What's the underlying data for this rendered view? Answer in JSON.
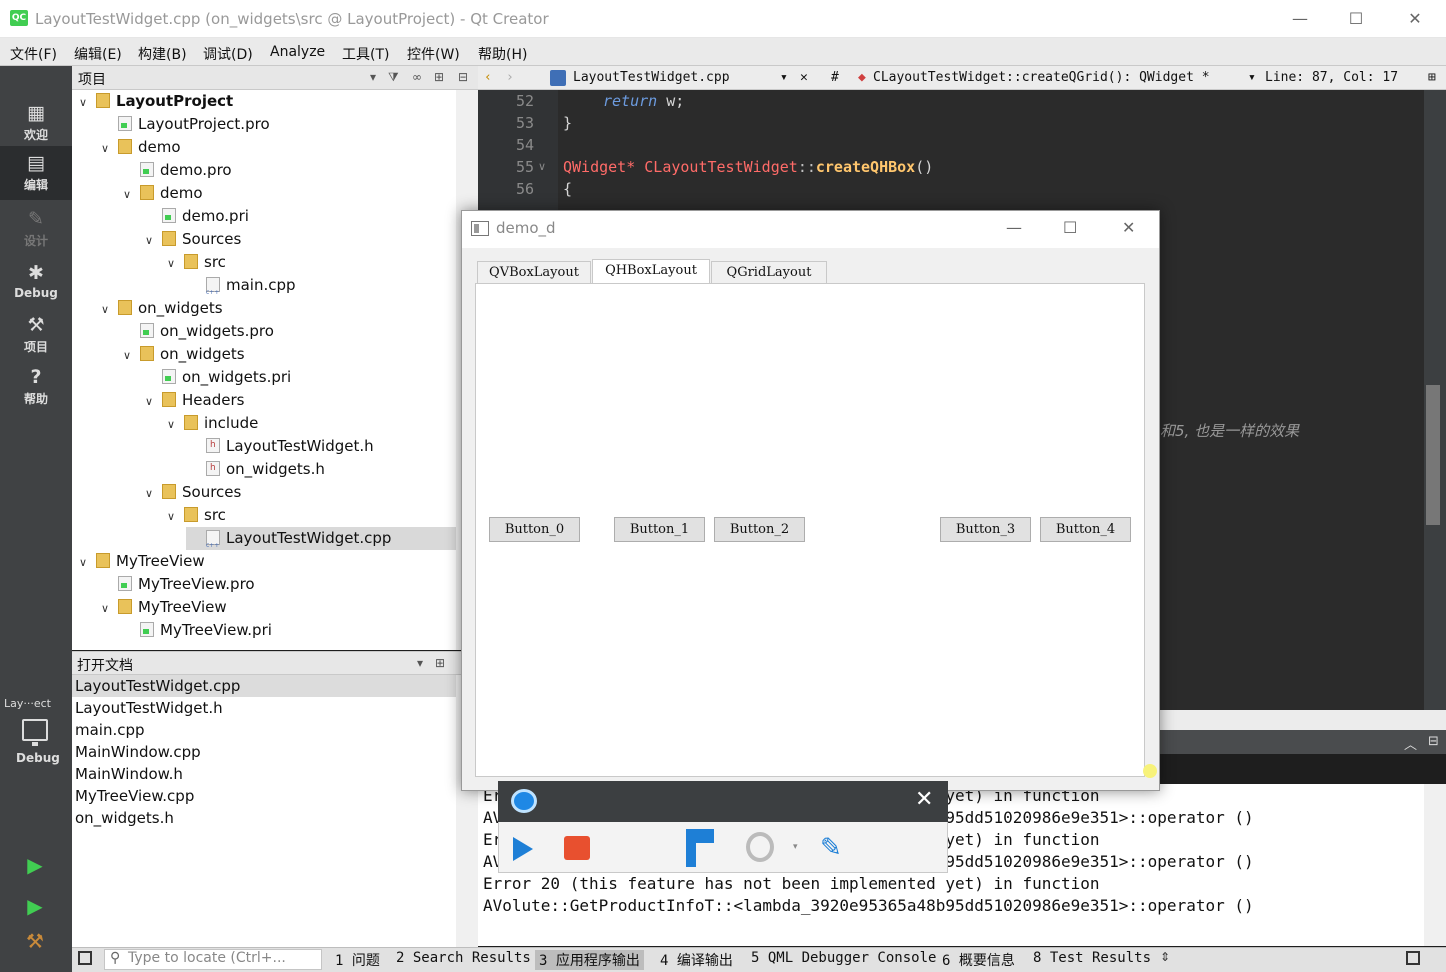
{
  "window": {
    "title": "LayoutTestWidget.cpp (on_widgets\\src @ LayoutProject) - Qt Creator",
    "icon_text": "QC"
  },
  "menu": [
    "文件(F)",
    "编辑(E)",
    "构建(B)",
    "调试(D)",
    "Analyze",
    "工具(T)",
    "控件(W)",
    "帮助(H)"
  ],
  "modes": [
    {
      "icon": "welcome-grid-icon",
      "label": "欢迎"
    },
    {
      "icon": "edit-icon",
      "label": "编辑"
    },
    {
      "icon": "design-icon",
      "label": "设计"
    },
    {
      "icon": "debug-bug-icon",
      "label": "Debug"
    },
    {
      "icon": "wrench-icon",
      "label": "项目"
    },
    {
      "icon": "help-icon",
      "label": "帮助"
    }
  ],
  "kit": {
    "project": "Lay···ect",
    "config": "Debug"
  },
  "project_panel": {
    "title": "项目",
    "tree": [
      {
        "label": "LayoutProject",
        "arrow": "∨",
        "type": "folder",
        "bold": true
      },
      {
        "label": "LayoutProject.pro",
        "arrow": "",
        "type": "pro"
      },
      {
        "label": "demo",
        "arrow": "∨",
        "type": "folder"
      },
      {
        "label": "demo.pro",
        "arrow": "",
        "type": "pro"
      },
      {
        "label": "demo",
        "arrow": "∨",
        "type": "folder"
      },
      {
        "label": "demo.pri",
        "arrow": "",
        "type": "pro"
      },
      {
        "label": "Sources",
        "arrow": "∨",
        "type": "folder"
      },
      {
        "label": "src",
        "arrow": "∨",
        "type": "folder"
      },
      {
        "label": "main.cpp",
        "arrow": "",
        "type": "cpp"
      },
      {
        "label": "on_widgets",
        "arrow": "∨",
        "type": "folder"
      },
      {
        "label": "on_widgets.pro",
        "arrow": "",
        "type": "pro"
      },
      {
        "label": "on_widgets",
        "arrow": "∨",
        "type": "folder"
      },
      {
        "label": "on_widgets.pri",
        "arrow": "",
        "type": "pro"
      },
      {
        "label": "Headers",
        "arrow": "∨",
        "type": "folder"
      },
      {
        "label": "include",
        "arrow": "∨",
        "type": "folder"
      },
      {
        "label": "LayoutTestWidget.h",
        "arrow": "",
        "type": "h"
      },
      {
        "label": "on_widgets.h",
        "arrow": "",
        "type": "h"
      },
      {
        "label": "Sources",
        "arrow": "∨",
        "type": "folder"
      },
      {
        "label": "src",
        "arrow": "∨",
        "type": "folder"
      },
      {
        "label": "LayoutTestWidget.cpp",
        "arrow": "",
        "type": "cpp",
        "selected": true
      },
      {
        "label": "MyTreeView",
        "arrow": "∨",
        "type": "folder"
      },
      {
        "label": "MyTreeView.pro",
        "arrow": "",
        "type": "pro"
      },
      {
        "label": "MyTreeView",
        "arrow": "∨",
        "type": "folder"
      },
      {
        "label": "MyTreeView.pri",
        "arrow": "",
        "type": "pro"
      }
    ]
  },
  "open_docs": {
    "title": "打开文档",
    "items": [
      "LayoutTestWidget.cpp",
      "LayoutTestWidget.h",
      "main.cpp",
      "MainWindow.cpp",
      "MainWindow.h",
      "MyTreeView.cpp",
      "on_widgets.h"
    ]
  },
  "editor_toolbar": {
    "file": "LayoutTestWidget.cpp",
    "hash": "#",
    "symbol": "CLayoutTestWidget::createQGrid(): QWidget *",
    "position": "Line: 87, Col: 17"
  },
  "editor": {
    "line_numbers": [
      "52",
      "53",
      "54",
      "55",
      "56"
    ],
    "code": {
      "l52_kw": "return",
      "l52_rest": " w;",
      "l53": "}",
      "l55_type": "QWidget*",
      "l55_cls": "CLayoutTestWidget",
      "l55_sep": "::",
      "l55_fn": "createQHBox",
      "l55_paren": "()",
      "l56": "{"
    },
    "comment_fragment": "和5, 也是一样的效果"
  },
  "output": {
    "lines": [
      "Error 20 (this feature has not been implemented yet) in function",
      "AVolute::GetProductInfoT::<lambda_3920e95365a48b95dd51020986e9e351>::operator ()",
      "Error 20 (this feature has not been implemented yet) in function",
      "AVolute::GetProductInfoT::<lambda_3920e95365a48b95dd51020986e9e351>::operator ()",
      "Error 20 (this feature has not been implemented yet) in function",
      "AVolute::GetProductInfoT::<lambda_3920e95365a48b95dd51020986e9e351>::operator ()"
    ]
  },
  "status_bar": {
    "locator_placeholder": "Type to locate (Ctrl+...",
    "panes": [
      "1 问题",
      "2 Search Results",
      "3 应用程序输出",
      "4 编译输出",
      "5 QML Debugger Console",
      "6 概要信息",
      "8 Test Results"
    ]
  },
  "demo_dialog": {
    "title": "demo_d",
    "tabs": [
      "QVBoxLayout",
      "QHBoxLayout",
      "QGridLayout"
    ],
    "active_tab": "QHBoxLayout",
    "buttons": [
      "Button_0",
      "Button_1",
      "Button_2",
      "Button_3",
      "Button_4"
    ]
  },
  "recorder": {
    "close": "✕"
  }
}
